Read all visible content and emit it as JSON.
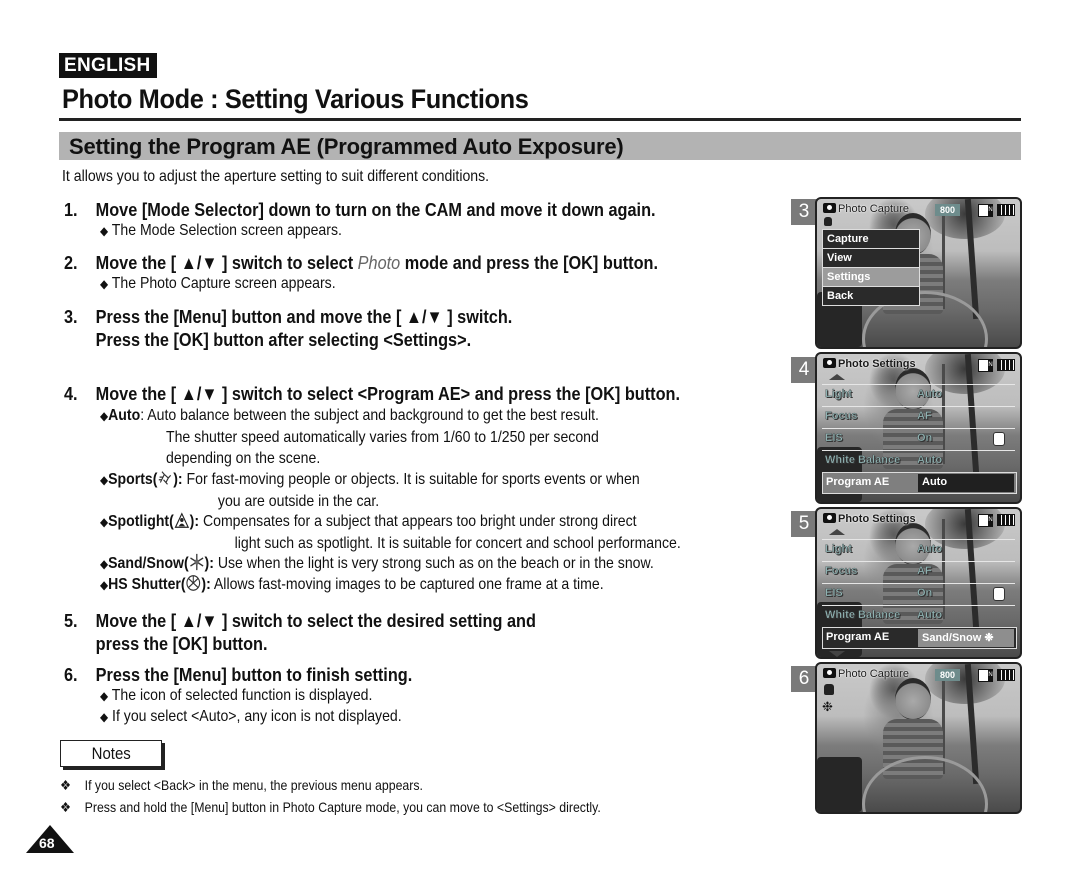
{
  "header": {
    "language_badge": "ENGLISH",
    "page_title": "Photo Mode : Setting Various Functions"
  },
  "section": {
    "title": "Setting the Program AE (Programmed Auto Exposure)",
    "intro": "It allows you to adjust the aperture setting to suit different conditions."
  },
  "steps": [
    {
      "num": "1.",
      "text": "Move [Mode Selector] down to turn on the CAM and move it down again.",
      "bullets": [
        "The Mode Selection screen appears."
      ]
    },
    {
      "num": "2.",
      "text_before": "Move the [ ▲/▼ ] switch to select ",
      "text_italic": "Photo",
      "text_after": " mode and press the [OK] button.",
      "bullets": [
        "The Photo Capture screen appears."
      ]
    },
    {
      "num": "3.",
      "text": "Press the [Menu] button and move the [ ▲/▼ ] switch.",
      "text_cont": "Press the [OK] button after selecting <Settings>."
    },
    {
      "num": "4.",
      "text": "Move the [ ▲/▼ ] switch to select <Program AE> and press the [OK] button.",
      "options": [
        {
          "name": "Auto",
          "icon": "",
          "desc": "Auto balance between the subject and background to get the best result.",
          "desc_cont": [
            "The shutter speed automatically varies from 1/60 to 1/250 per second",
            "depending on the scene."
          ]
        },
        {
          "name": "Sports(",
          "icon": "sports-icon",
          "desc": "For fast-moving people or objects. It is suitable for sports events or when",
          "desc_cont": [
            "you are outside in the car."
          ]
        },
        {
          "name": "Spotlight(",
          "icon": "spotlight-icon",
          "desc": "Compensates for a subject that appears too bright under strong direct",
          "desc_cont": [
            "light such as spotlight. It is suitable for concert and school performance."
          ]
        },
        {
          "name": "Sand/Snow(",
          "icon": "sand-snow-icon",
          "desc": "Use when the light is very strong such as on the beach or in the snow.",
          "desc_cont": []
        },
        {
          "name": "HS Shutter(",
          "icon": "hs-shutter-icon",
          "desc": "Allows fast-moving images to be captured one frame at a time.",
          "desc_cont": []
        }
      ]
    },
    {
      "num": "5.",
      "text": "Move the [ ▲/▼ ] switch to select the desired setting and",
      "text_cont": "press the [OK] button."
    },
    {
      "num": "6.",
      "text": "Press the [Menu] button to finish setting.",
      "bullets": [
        "The icon of selected function is displayed.",
        "If you select <Auto>, any icon is not displayed."
      ]
    }
  ],
  "symbols": {
    "bullet": "◆",
    "note_mark": "❖",
    "option_sep": "):",
    "auto_sep": ":"
  },
  "notes": {
    "label": "Notes",
    "items": [
      "If you select <Back> in the menu, the previous menu appears.",
      "Press and hold the [Menu] button in Photo Capture mode, you can move to <Settings> directly."
    ]
  },
  "page_number": "68",
  "screens": [
    {
      "label": "3",
      "title": "Photo Capture",
      "resolution": "800",
      "menu": [
        "Capture",
        "View",
        "Settings",
        "Back"
      ],
      "selected_menu": "Settings"
    },
    {
      "label": "4",
      "title": "Photo Settings",
      "rows": [
        {
          "label": "Light",
          "value": "Auto"
        },
        {
          "label": "Focus",
          "value": "AF"
        },
        {
          "label": "EIS",
          "value": "On"
        },
        {
          "label": "White Balance",
          "value": "Auto"
        }
      ],
      "active_row": {
        "label": "Program AE",
        "value": "Auto"
      }
    },
    {
      "label": "5",
      "title": "Photo Settings",
      "rows": [
        {
          "label": "Light",
          "value": "Auto"
        },
        {
          "label": "Focus",
          "value": "AF"
        },
        {
          "label": "EIS",
          "value": "On"
        },
        {
          "label": "White Balance",
          "value": "Auto"
        }
      ],
      "active_row": {
        "label": "Program AE",
        "value": "Sand/Snow ❉"
      }
    },
    {
      "label": "6",
      "title": "Photo Capture",
      "resolution": "800",
      "snow_icon": "❉"
    }
  ]
}
